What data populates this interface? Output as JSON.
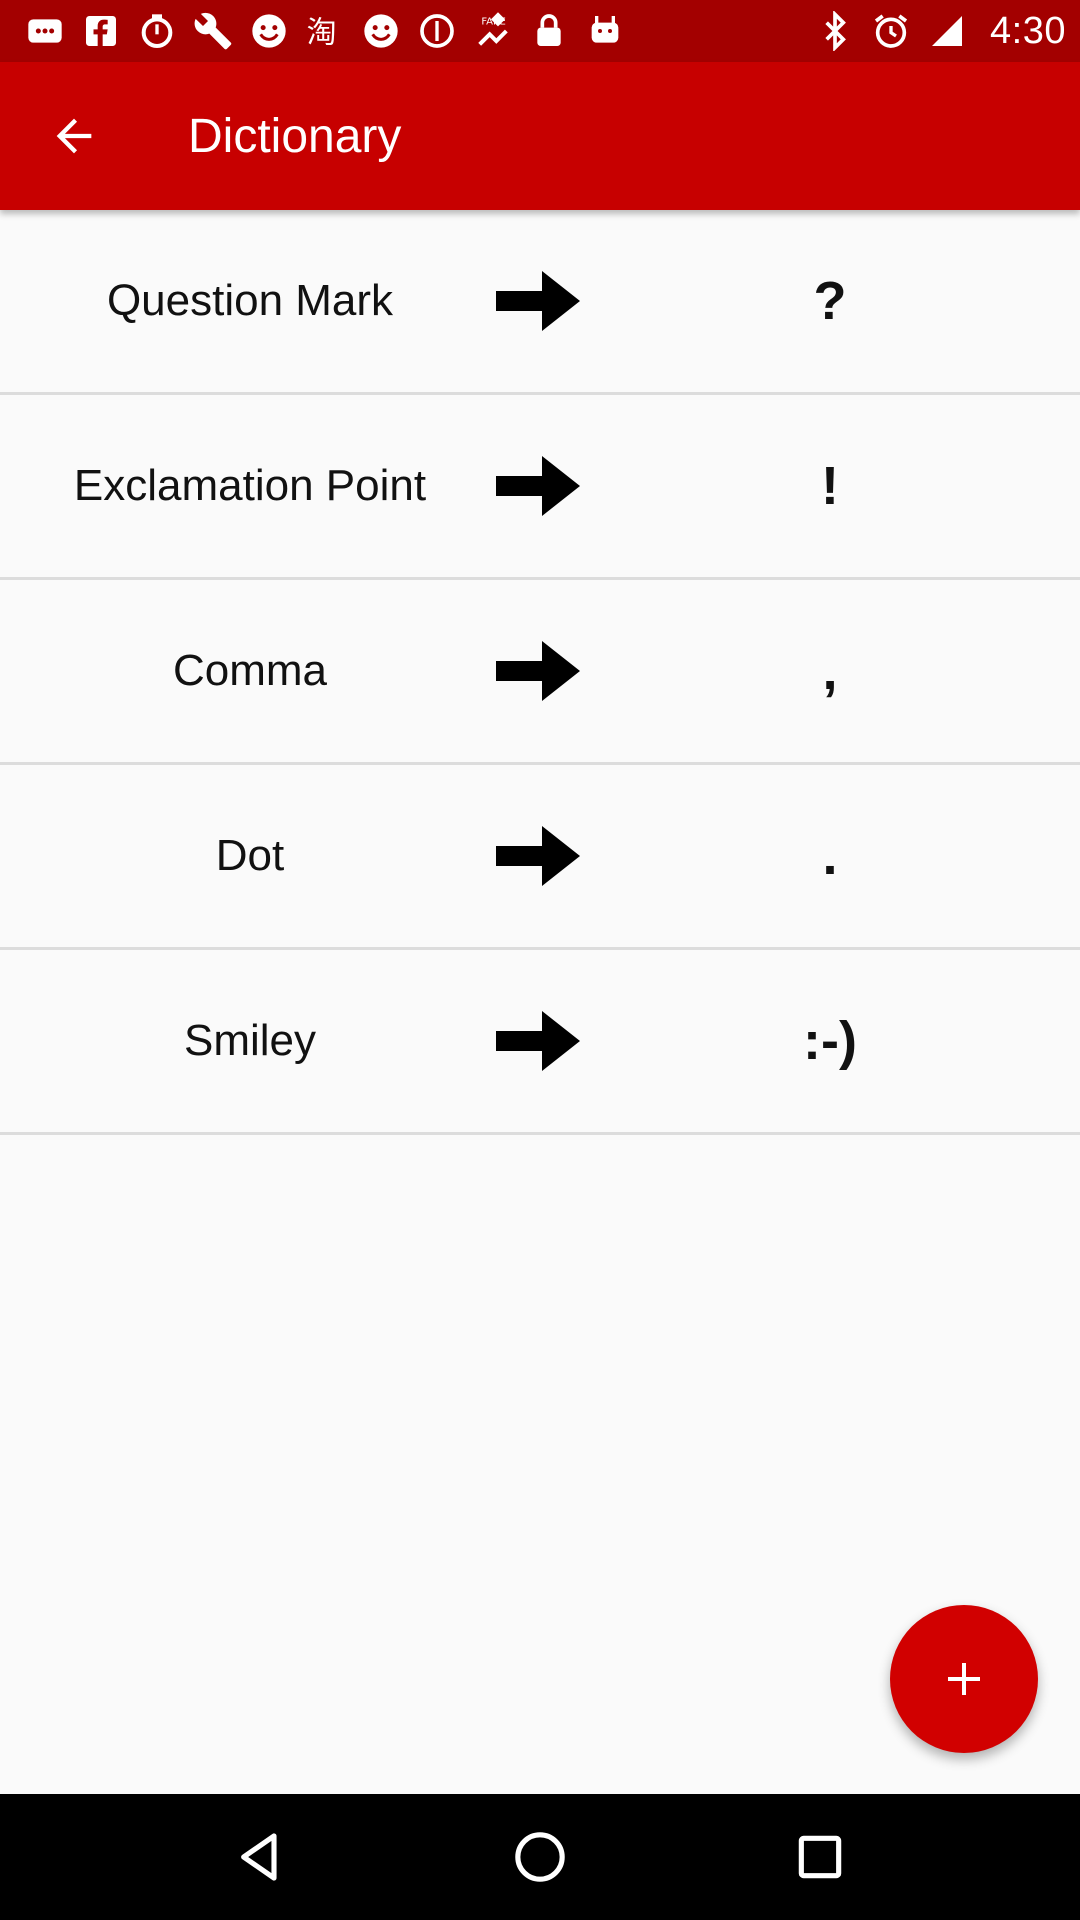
{
  "status_bar": {
    "time": "4:30",
    "icons": [
      "chat-icon",
      "facebook-icon",
      "stopwatch-icon",
      "wrench-icon",
      "smiley-icon",
      "taobao-icon",
      "smiley-icon",
      "info-icon",
      "fake-gps-icon",
      "lock-icon",
      "android-icon",
      "bluetooth-icon",
      "alarm-icon",
      "signal-icon"
    ]
  },
  "app_bar": {
    "title": "Dictionary",
    "back_icon": "arrow-back-icon",
    "background": "#c70000"
  },
  "dictionary": {
    "entries": [
      {
        "word": "Question Mark",
        "symbol": "?"
      },
      {
        "word": "Exclamation Point",
        "symbol": "!"
      },
      {
        "word": "Comma",
        "symbol": ","
      },
      {
        "word": "Dot",
        "symbol": "."
      },
      {
        "word": "Smiley",
        "symbol": ":-)"
      }
    ],
    "arrow_icon": "arrow-right-icon"
  },
  "fab": {
    "icon": "plus-icon",
    "color": "#d10000"
  },
  "nav_bar": {
    "buttons": [
      "back-triangle-icon",
      "home-circle-icon",
      "recents-square-icon"
    ]
  }
}
